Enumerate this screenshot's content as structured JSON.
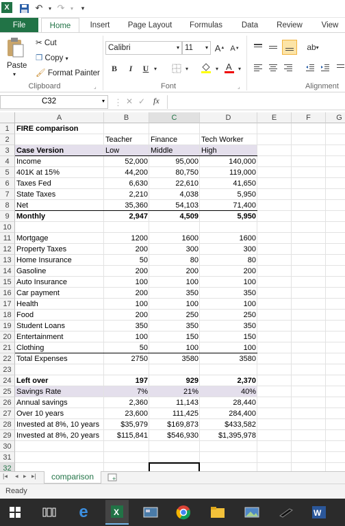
{
  "ribbon_tabs": [
    "File",
    "Home",
    "Insert",
    "Page Layout",
    "Formulas",
    "Data",
    "Review",
    "View"
  ],
  "clipboard": {
    "paste": "Paste",
    "cut": "Cut",
    "copy": "Copy",
    "format_painter": "Format Painter",
    "group": "Clipboard"
  },
  "font": {
    "name": "Calibri",
    "size": "11",
    "group": "Font",
    "bold": "B",
    "italic": "I",
    "underline": "U"
  },
  "alignment": {
    "group": "Alignment"
  },
  "formula_bar": {
    "name_box": "C32",
    "fx": "fx",
    "formula": ""
  },
  "columns": [
    "A",
    "B",
    "C",
    "D",
    "E",
    "F",
    "G"
  ],
  "rows": [
    "1",
    "2",
    "3",
    "4",
    "5",
    "6",
    "7",
    "8",
    "9",
    "10",
    "11",
    "12",
    "13",
    "14",
    "15",
    "16",
    "17",
    "18",
    "19",
    "20",
    "21",
    "22",
    "23",
    "24",
    "25",
    "26",
    "27",
    "28",
    "29",
    "30",
    "31",
    "32"
  ],
  "cells": {
    "A1": "FIRE comparison",
    "B2": "Teacher",
    "C2": "Finance",
    "D2": "Tech  Worker",
    "A3": "Case Version",
    "B3": "Low",
    "C3": "Middle",
    "D3": "High",
    "A4": "Income",
    "B4": "52,000",
    "C4": "95,000",
    "D4": "140,000",
    "A5": "401K at 15%",
    "B5": "44,200",
    "C5": "80,750",
    "D5": "119,000",
    "A6": "Taxes Fed",
    "B6": "6,630",
    "C6": "22,610",
    "D6": "41,650",
    "A7": "State Taxes",
    "B7": "2,210",
    "C7": "4,038",
    "D7": "5,950",
    "A8": "Net",
    "B8": "35,360",
    "C8": "54,103",
    "D8": "71,400",
    "A9": "Monthly",
    "B9": "2,947",
    "C9": "4,509",
    "D9": "5,950",
    "A11": "Mortgage",
    "B11": "1200",
    "C11": "1600",
    "D11": "1600",
    "A12": "Property Taxes",
    "B12": "200",
    "C12": "300",
    "D12": "300",
    "A13": "Home Insurance",
    "B13": "50",
    "C13": "80",
    "D13": "80",
    "A14": "Gasoline",
    "B14": "200",
    "C14": "200",
    "D14": "200",
    "A15": "Auto Insurance",
    "B15": "100",
    "C15": "100",
    "D15": "100",
    "A16": "Car payment",
    "B16": "200",
    "C16": "350",
    "D16": "350",
    "A17": "Health",
    "B17": "100",
    "C17": "100",
    "D17": "100",
    "A18": "Food",
    "B18": "200",
    "C18": "250",
    "D18": "250",
    "A19": "Student Loans",
    "B19": "350",
    "C19": "350",
    "D19": "350",
    "A20": "Entertainment",
    "B20": "100",
    "C20": "150",
    "D20": "150",
    "A21": "Clothing",
    "B21": "50",
    "C21": "100",
    "D21": "100",
    "A22": "Total Expenses",
    "B22": "2750",
    "C22": "3580",
    "D22": "3580",
    "A24": "Left over",
    "B24": "197",
    "C24": "929",
    "D24": "2,370",
    "A25": "Savings Rate",
    "B25": "7%",
    "C25": "21%",
    "D25": "40%",
    "A26": "Annual savings",
    "B26": "2,360",
    "C26": "11,143",
    "D26": "28,440",
    "A27": "Over 10 years",
    "B27": "23,600",
    "C27": "111,425",
    "D27": "284,400",
    "A28": "Invested at 8%, 10 years",
    "B28": "$35,979",
    "C28": "$169,873",
    "D28": "$433,582",
    "A29": "Invested at 8%, 20 years",
    "B29": "$115,841",
    "C29": "$546,930",
    "D29": "$1,395,978"
  },
  "sheet_tab": "comparison",
  "status": "Ready",
  "colors": {
    "excel_green": "#217346",
    "header_fill": "#e4dfec",
    "taskbar": "#2b2b2b"
  }
}
